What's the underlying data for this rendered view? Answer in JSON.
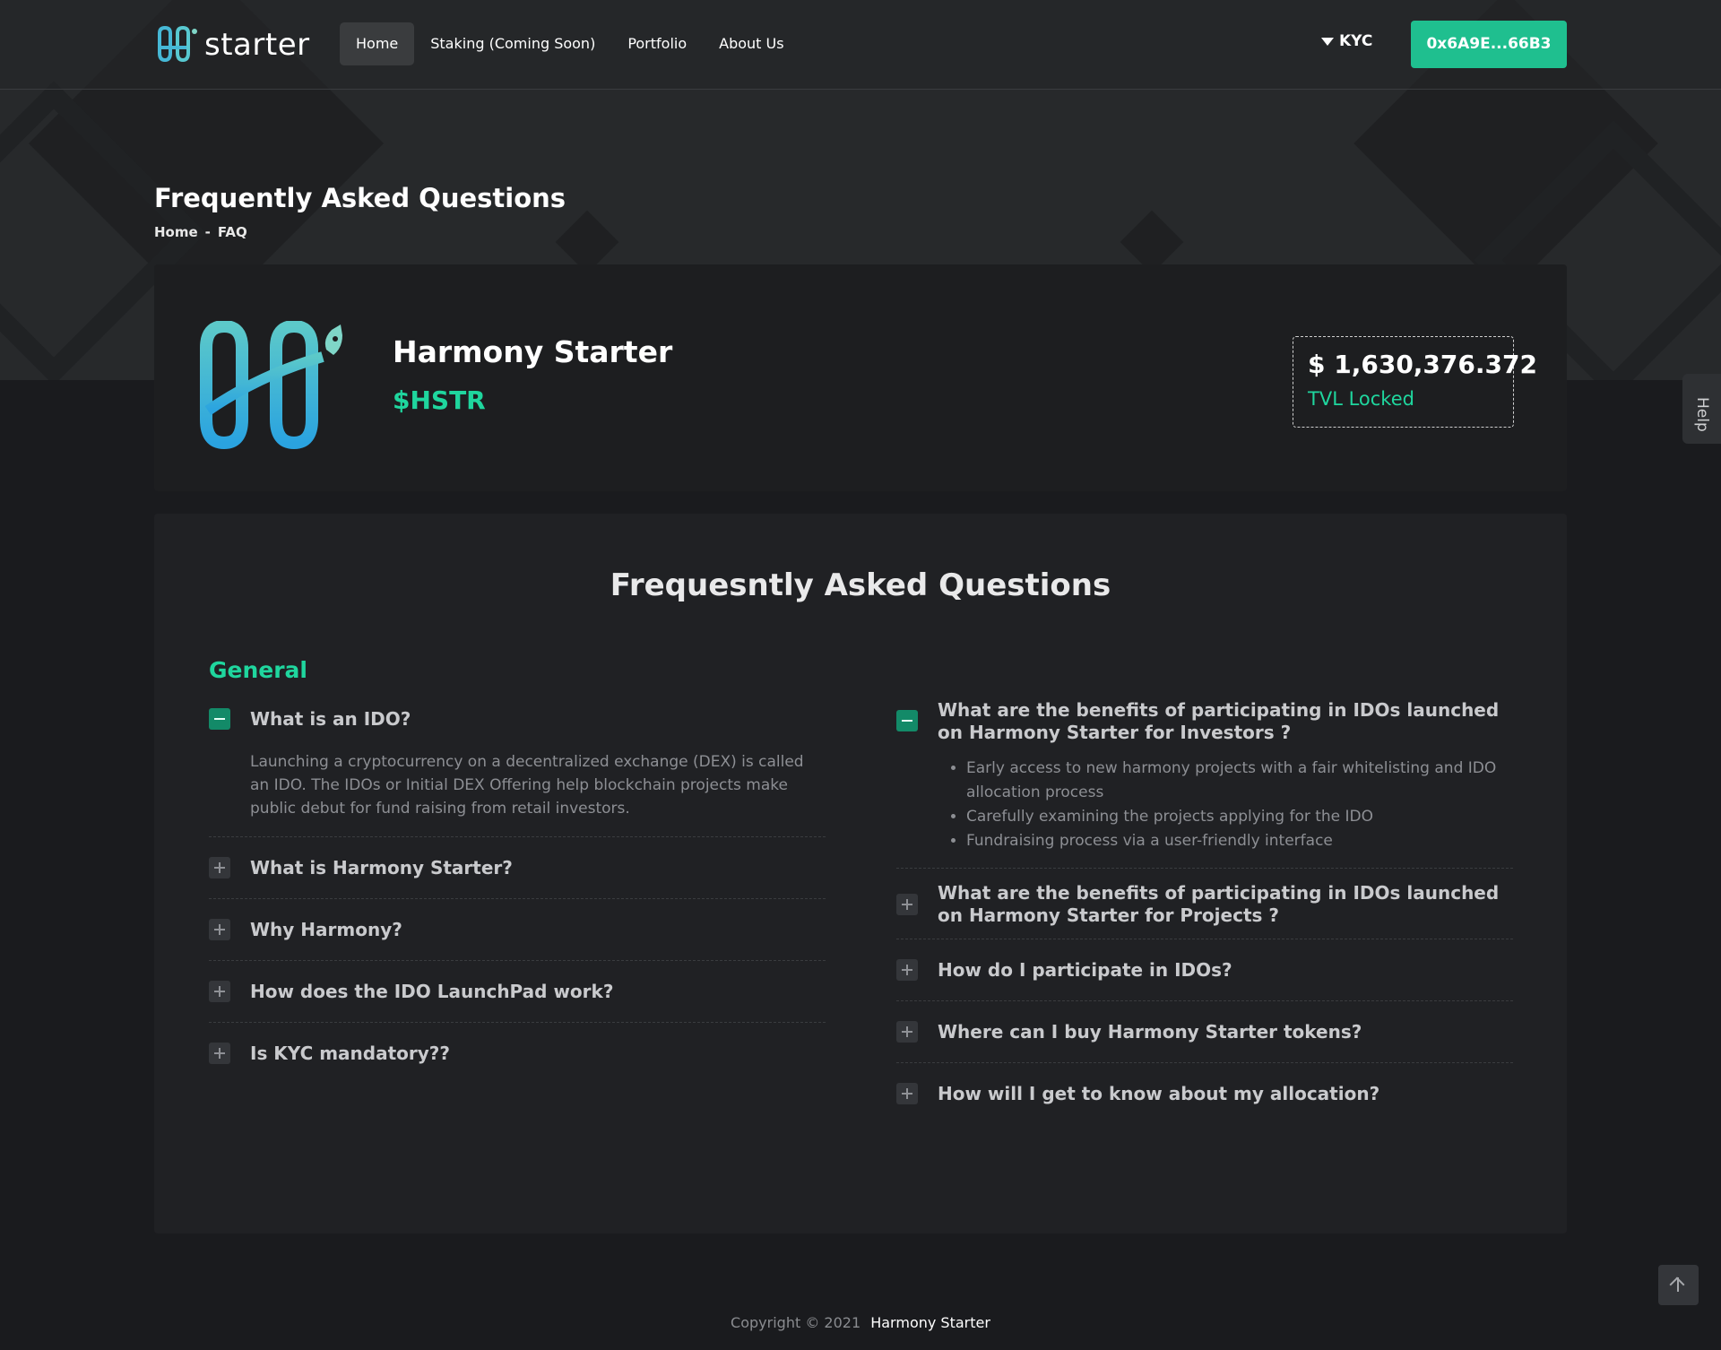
{
  "nav": {
    "logo_text": "starter",
    "links": [
      {
        "label": "Home",
        "active": true
      },
      {
        "label": "Staking (Coming Soon)",
        "active": false
      },
      {
        "label": "Portfolio",
        "active": false
      },
      {
        "label": "About Us",
        "active": false
      }
    ],
    "kyc_label": "KYC",
    "wallet_address": "0x6A9E...66B3"
  },
  "header": {
    "title": "Frequently Asked Questions",
    "breadcrumb": {
      "home": "Home",
      "separator": "-",
      "current": "FAQ"
    }
  },
  "project": {
    "name": "Harmony Starter",
    "ticker": "$HSTR",
    "tvl_amount": "$ 1,630,376.372",
    "tvl_label": "TVL Locked"
  },
  "help_tab": "Help",
  "faq": {
    "heading": "Frequesntly Asked Questions",
    "category": "General",
    "left": [
      {
        "question": "What is an IDO?",
        "open": true,
        "answer": "Launching a cryptocurrency on a decentralized exchange (DEX) is called an IDO. The IDOs or Initial DEX Offering help blockchain projects make public debut for fund raising from retail investors."
      },
      {
        "question": "What is Harmony Starter?",
        "open": false
      },
      {
        "question": "Why Harmony?",
        "open": false
      },
      {
        "question": "How does the IDO LaunchPad work?",
        "open": false
      },
      {
        "question": "Is KYC mandatory??",
        "open": false
      }
    ],
    "right": [
      {
        "question": "What are the benefits of participating in IDOs launched on Harmony Starter for Investors ?",
        "open": true,
        "bullets": [
          "Early access to new harmony projects with a fair whitelisting and IDO allocation process",
          "Carefully examining the projects applying for the IDO",
          "Fundraising process via a user-friendly interface"
        ]
      },
      {
        "question": "What are the benefits of participating in IDOs launched on Harmony Starter for Projects ?",
        "open": false
      },
      {
        "question": "How do I participate in IDOs?",
        "open": false
      },
      {
        "question": "Where can I buy Harmony Starter tokens?",
        "open": false
      },
      {
        "question": "How will I get to know about my allocation?",
        "open": false
      }
    ]
  },
  "footer": {
    "copyright": "Copyright © 2021",
    "brand": "Harmony Starter"
  },
  "colors": {
    "accent": "#1fd69e",
    "button": "#1fbf8f",
    "background": "#1a1b1e",
    "card": "#202124"
  },
  "icons": [
    "logo-icon",
    "funnel-icon",
    "rocket-icon",
    "plus-icon",
    "minus-icon",
    "arrow-up-icon"
  ]
}
